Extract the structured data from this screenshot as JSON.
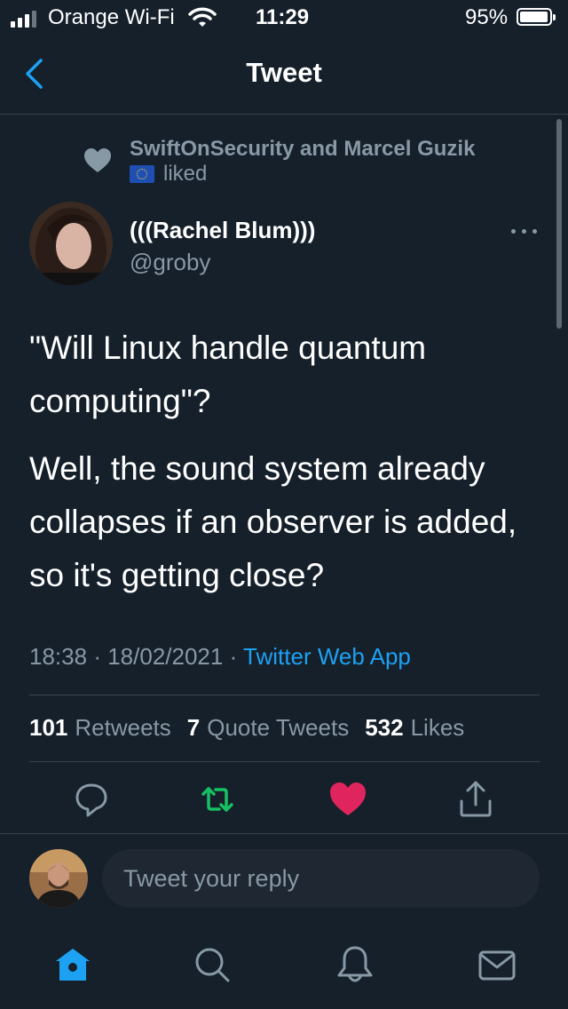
{
  "status_bar": {
    "carrier": "Orange Wi-Fi",
    "time": "11:29",
    "battery": "95%"
  },
  "header": {
    "title": "Tweet",
    "back_icon": "chevron-left-icon"
  },
  "social_context": {
    "line1": "SwiftOnSecurity and Marcel Guzik",
    "line2": "liked"
  },
  "author": {
    "name": "(((Rachel Blum)))",
    "handle": "@groby"
  },
  "tweet": {
    "paragraph1": "\"Will Linux handle quantum computing\"?",
    "paragraph2": "Well, the sound system already collapses if an observer is added, so it's getting close?",
    "time": "18:38",
    "date": "18/02/2021",
    "source": "Twitter Web App",
    "separator": "·"
  },
  "stats": {
    "retweets_count": "101",
    "retweets_label": "Retweets",
    "quotes_count": "7",
    "quotes_label": "Quote Tweets",
    "likes_count": "532",
    "likes_label": "Likes"
  },
  "actions": [
    "reply-icon",
    "retweet-icon",
    "like-icon",
    "share-icon"
  ],
  "reply": {
    "placeholder": "Tweet your reply"
  },
  "nav": [
    "home-icon",
    "search-icon",
    "notifications-icon",
    "messages-icon"
  ],
  "colors": {
    "background": "#15202b",
    "accent": "#1da1f2",
    "retweet": "#17bf63",
    "like": "#e0245e",
    "muted": "#8899a6"
  }
}
